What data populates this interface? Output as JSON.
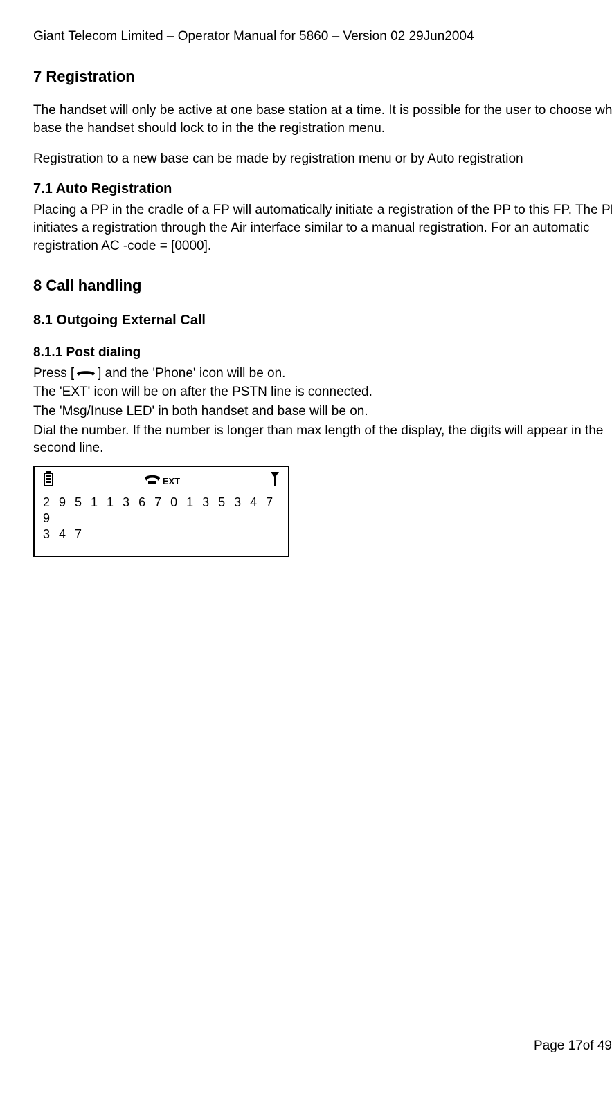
{
  "header": "Giant Telecom Limited – Operator Manual for 5860 – Version 02 29Jun2004",
  "sec7": {
    "title": "7    Registration",
    "p1": "The handset will only be active at one base station at a time. It is possible for the user to choose which base the handset should lock to in the the registration menu.",
    "p2": "Registration to a new base can be made by registration menu or by Auto registration",
    "sub71_title": "7.1    Auto Registration",
    "sub71_p": "Placing a PP in the cradle of a FP will automatically initiate a registration of the PP to this FP. The PP initiates a registration through the Air interface similar to a manual registration. For an automatic registration AC -code = [0000]."
  },
  "sec8": {
    "title": "8    Call handling",
    "sub81_title": "8.1    Outgoing External Call",
    "sub811_title": "8.1.1   Post dialing",
    "p_press_a": "Press [",
    "p_press_b": "] and the 'Phone' icon will be on.",
    "p_ext": "The 'EXT' icon will be on after the PSTN line is connected.",
    "p_led": "The 'Msg/Inuse LED' in both handset and base will be on.",
    "p_dial": "Dial the number. If the number is longer than max length of the display, the digits will appear in the second line."
  },
  "display": {
    "ext": "EXT",
    "line1": "2 9 5 1 1 3 6 7 0 1 3 5 3 4 7 9",
    "line2": "3 4 7"
  },
  "footer": "Page 17of 49"
}
